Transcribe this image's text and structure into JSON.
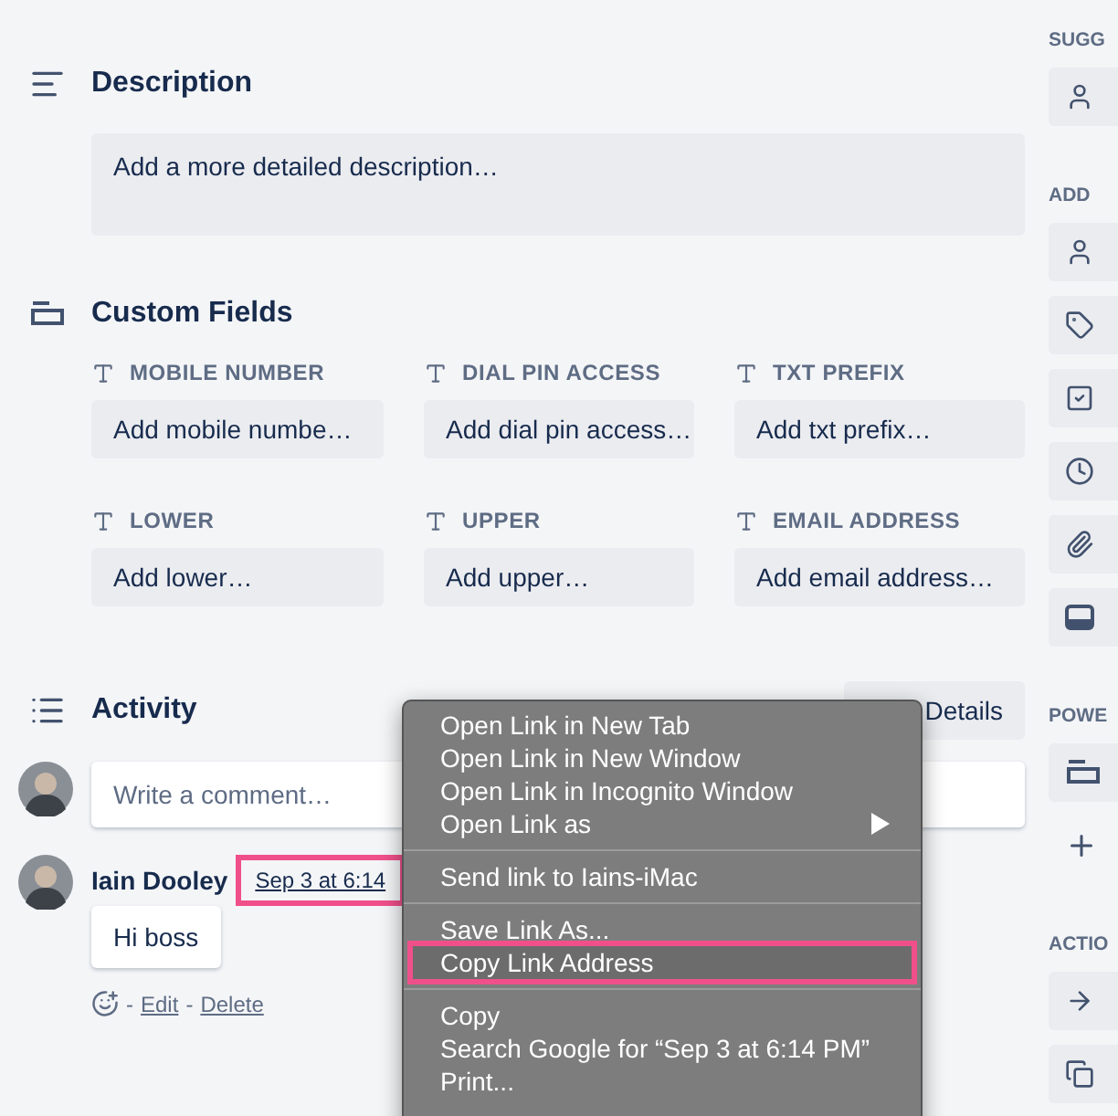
{
  "description": {
    "title": "Description",
    "placeholder": "Add a more detailed description…"
  },
  "custom_fields": {
    "title": "Custom Fields",
    "fields": [
      {
        "label": "MOBILE NUMBER",
        "placeholder": "Add mobile numbe…"
      },
      {
        "label": "DIAL PIN ACCESS",
        "placeholder": "Add dial pin access…"
      },
      {
        "label": "TXT PREFIX",
        "placeholder": "Add txt prefix…"
      },
      {
        "label": "LOWER",
        "placeholder": "Add lower…"
      },
      {
        "label": "UPPER",
        "placeholder": "Add upper…"
      },
      {
        "label": "EMAIL ADDRESS",
        "placeholder": "Add email address…"
      }
    ]
  },
  "activity": {
    "title": "Activity",
    "show_details": "Details",
    "comment_placeholder": "Write a comment…",
    "comments": [
      {
        "author": "Iain Dooley",
        "timestamp": "Sep 3 at 6:14",
        "highlighted": true,
        "text": "Hi boss",
        "separator": "-",
        "actions": [
          "Edit",
          "Delete"
        ]
      }
    ]
  },
  "context_menu": {
    "groups": [
      [
        {
          "label": "Open Link in New Tab",
          "submenu": false,
          "highlighted": false
        },
        {
          "label": "Open Link in New Window",
          "submenu": false,
          "highlighted": false
        },
        {
          "label": "Open Link in Incognito Window",
          "submenu": false,
          "highlighted": false
        },
        {
          "label": "Open Link as",
          "submenu": true,
          "highlighted": false
        }
      ],
      [
        {
          "label": "Send link to Iains-iMac",
          "submenu": false,
          "highlighted": false
        }
      ],
      [
        {
          "label": "Save Link As...",
          "submenu": false,
          "highlighted": false
        },
        {
          "label": "Copy Link Address",
          "submenu": false,
          "highlighted": true
        }
      ],
      [
        {
          "label": "Copy",
          "submenu": false,
          "highlighted": false
        },
        {
          "label": "Search Google for “Sep 3 at 6:14 PM”",
          "submenu": false,
          "highlighted": false
        },
        {
          "label": "Print...",
          "submenu": false,
          "highlighted": false
        }
      ]
    ]
  },
  "sidebar": {
    "sections": [
      {
        "heading": "SUGG",
        "items": [
          {
            "kind": "person"
          }
        ]
      },
      {
        "heading": "ADD",
        "items": [
          {
            "kind": "person"
          },
          {
            "kind": "tag"
          },
          {
            "kind": "checklist"
          },
          {
            "kind": "clock"
          },
          {
            "kind": "paperclip"
          },
          {
            "kind": "cover"
          }
        ]
      },
      {
        "heading": "POWE",
        "items": [
          {
            "kind": "card"
          },
          {
            "kind": "add"
          }
        ]
      },
      {
        "heading": "ACTIO",
        "items": [
          {
            "kind": "arrow"
          },
          {
            "kind": "copy"
          }
        ]
      }
    ]
  }
}
